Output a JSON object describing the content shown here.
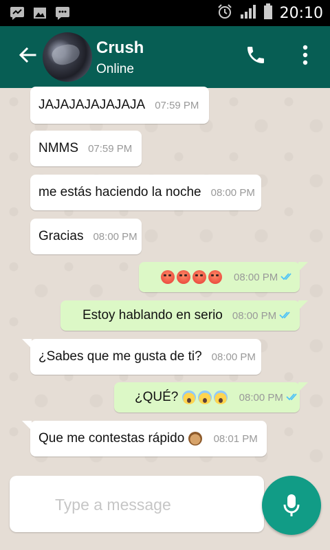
{
  "status_bar": {
    "time": "20:10"
  },
  "header": {
    "contact_name": "Crush",
    "contact_status": "Online"
  },
  "colors": {
    "header": "#075e54",
    "outgoing_bubble": "#dcf8c6",
    "incoming_bubble": "#ffffff",
    "mic_button": "#119c86",
    "read_ticks": "#4fc3f7"
  },
  "messages": [
    {
      "direction": "in",
      "text": "JAJAJAJAJAJAJA",
      "time": "07:59 PM"
    },
    {
      "direction": "in",
      "text": "NMMS",
      "time": "07:59 PM"
    },
    {
      "direction": "in",
      "text": "me estás haciendo la noche",
      "time": "08:00 PM"
    },
    {
      "direction": "in",
      "text": "Gracias",
      "time": "08:00 PM"
    },
    {
      "direction": "out",
      "text": "",
      "emoji": [
        "pouting-face",
        "pouting-face",
        "pouting-face",
        "pouting-face"
      ],
      "time": "08:00 PM",
      "status": "read"
    },
    {
      "direction": "out",
      "text": "Estoy hablando en serio",
      "time": "08:00 PM",
      "status": "read"
    },
    {
      "direction": "in",
      "text": "¿Sabes que me gusta de ti?",
      "time": "08:00 PM"
    },
    {
      "direction": "out",
      "text": "¿QUÉ?",
      "emoji": [
        "face-screaming-in-fear",
        "face-screaming-in-fear",
        "face-screaming-in-fear"
      ],
      "time": "08:00 PM",
      "status": "read"
    },
    {
      "direction": "in",
      "text": "Que me contestas rápido",
      "emoji": [
        "see-no-evil-monkey"
      ],
      "time": "08:01 PM"
    }
  ],
  "composer": {
    "placeholder": "Type a message"
  },
  "icons": [
    "back-arrow-icon",
    "phone-icon",
    "more-vert-icon",
    "microphone-icon"
  ]
}
